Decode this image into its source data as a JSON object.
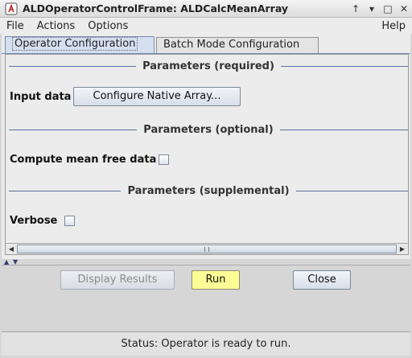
{
  "window": {
    "title": "ALDOperatorControlFrame: ALDCalcMeanArray",
    "controls": {
      "up": "↑",
      "minimize": "▾",
      "maximize": "□",
      "close": "✕"
    }
  },
  "menu": {
    "file": "File",
    "actions": "Actions",
    "options": "Options",
    "help": "Help"
  },
  "tabs": {
    "operator": "Operator Configuration",
    "batch": "Batch Mode Configuration"
  },
  "sections": {
    "required": "Parameters (required)",
    "optional": "Parameters (optional)",
    "supplemental": "Parameters (supplemental)"
  },
  "params": {
    "input_data_label": "Input data",
    "configure_button": "Configure Native Array...",
    "mean_free_label": "Compute mean free data",
    "mean_free_checked": false,
    "verbose_label": "Verbose",
    "verbose_checked": false
  },
  "buttons": {
    "display_results": "Display Results",
    "run": "Run",
    "close": "Close"
  },
  "status": {
    "text": "Status: Operator is ready to run."
  },
  "colors": {
    "run_button": "#fdfd96",
    "section_line": "#5b6e9c",
    "active_tab": "#d5dff0"
  }
}
